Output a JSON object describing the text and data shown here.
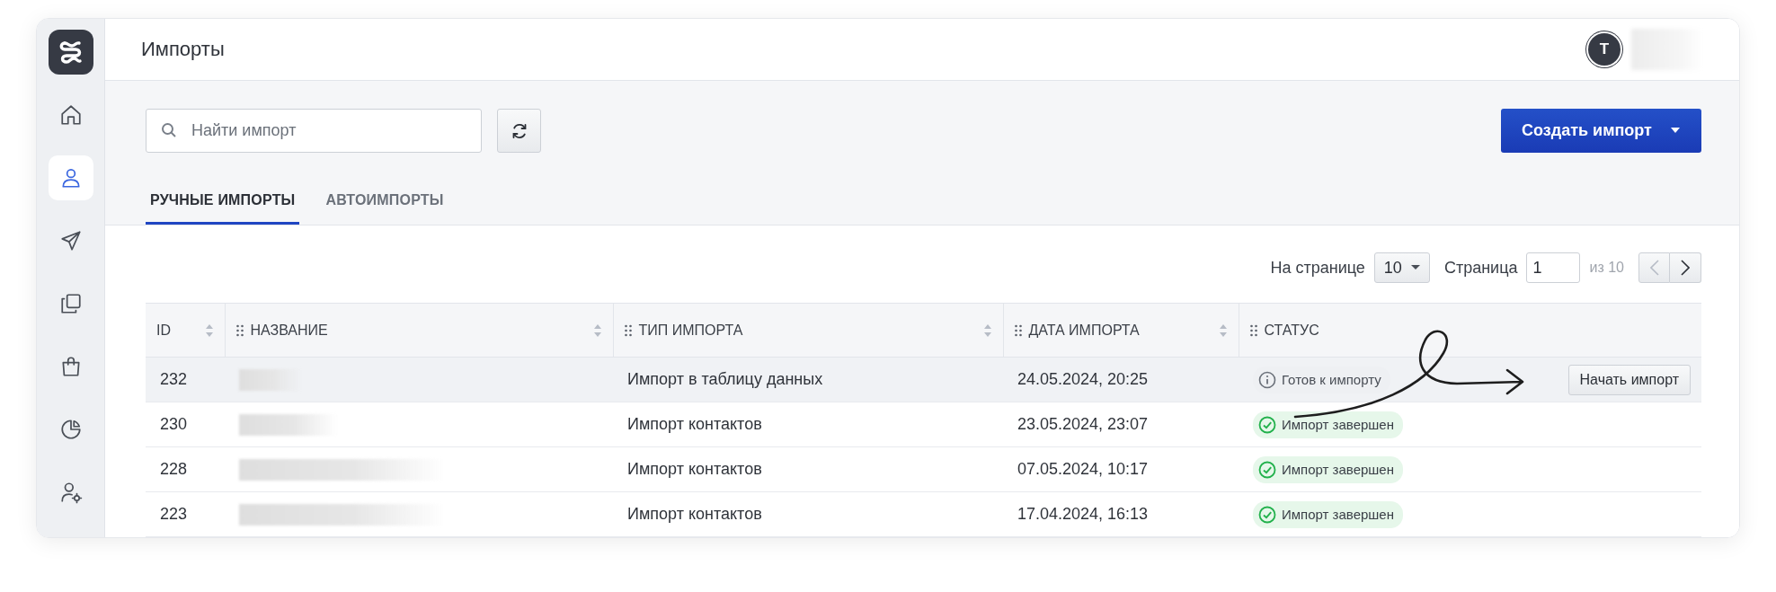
{
  "sidebar": {
    "items": [
      {
        "kind": "home",
        "selected": false
      },
      {
        "kind": "user",
        "selected": true
      },
      {
        "kind": "send",
        "selected": false
      },
      {
        "kind": "copy",
        "selected": false
      },
      {
        "kind": "bag",
        "selected": false
      },
      {
        "kind": "chart",
        "selected": false
      },
      {
        "kind": "user-settings",
        "selected": false
      }
    ]
  },
  "header": {
    "title": "Импорты",
    "avatar": "T"
  },
  "toolbar": {
    "search": {
      "placeholder": "Найти импорт"
    },
    "create_button": "Создать импорт"
  },
  "tabs": [
    {
      "label": "РУЧНЫЕ ИМПОРТЫ",
      "selected": true
    },
    {
      "label": "АВТОИМПОРТЫ",
      "selected": false
    }
  ],
  "pagination": {
    "per_page_label": "На странице",
    "per_page": "10",
    "page_label": "Страница",
    "page": "1",
    "total": "из 10",
    "prev_disabled": true,
    "next_disabled": false
  },
  "table": {
    "columns": [
      {
        "label": "ID",
        "sortable": true,
        "draggable": false
      },
      {
        "label": "НАЗВАНИЕ",
        "sortable": true,
        "draggable": true
      },
      {
        "label": "ТИП ИМПОРТА",
        "sortable": true,
        "draggable": true
      },
      {
        "label": "ДАТА ИМПОРТА",
        "sortable": true,
        "draggable": true
      },
      {
        "label": "СТАТУС",
        "sortable": false,
        "draggable": true
      }
    ],
    "rows": [
      {
        "id": "232",
        "type": "Импорт в таблицу данных",
        "date": "24.05.2024, 20:25",
        "status": {
          "kind": "ready",
          "label": "Готов к импорту"
        },
        "action": "Начать импорт",
        "highlighted": true
      },
      {
        "id": "230",
        "type": "Импорт контактов",
        "date": "23.05.2024, 23:07",
        "status": {
          "kind": "done",
          "label": "Импорт завершен"
        },
        "highlighted": false
      },
      {
        "id": "228",
        "type": "Импорт контактов",
        "date": "07.05.2024, 10:17",
        "status": {
          "kind": "done",
          "label": "Импорт завершен"
        },
        "highlighted": false
      },
      {
        "id": "223",
        "type": "Импорт контактов",
        "date": "17.04.2024, 16:13",
        "status": {
          "kind": "done",
          "label": "Импорт завершен"
        },
        "highlighted": false
      }
    ]
  }
}
